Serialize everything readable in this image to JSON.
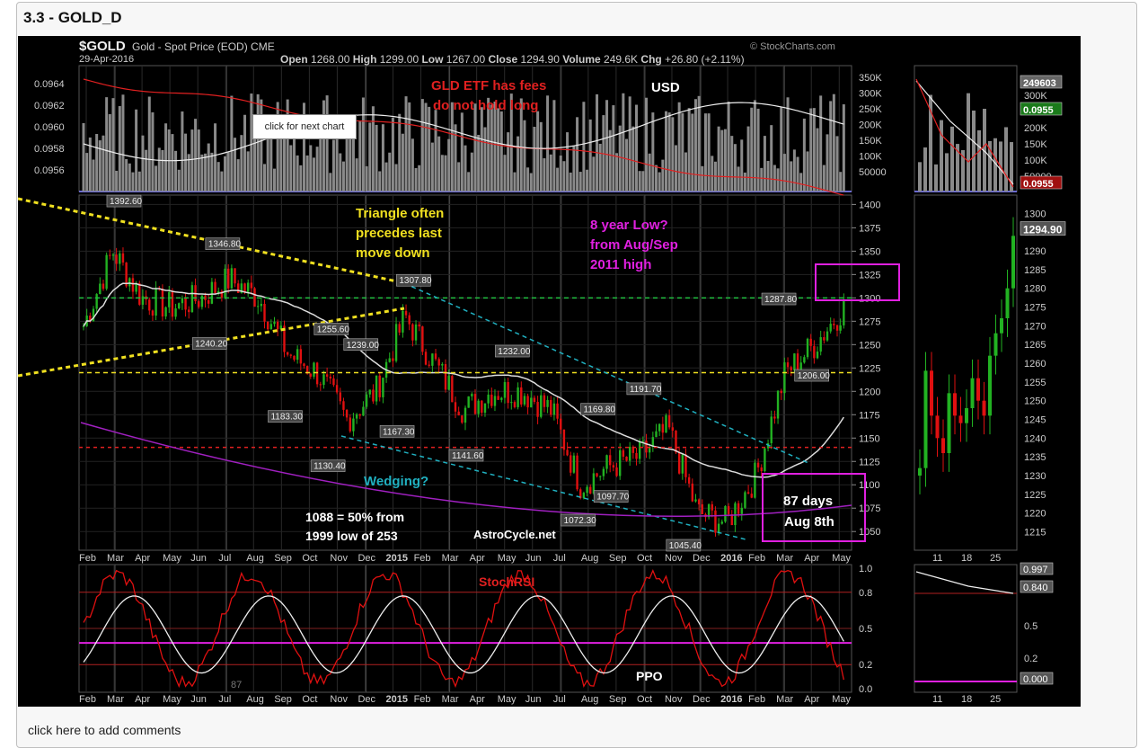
{
  "page": {
    "title": "3.3 - GOLD_D",
    "comments_link": "click here to add comments",
    "next_chart_button": "click for next chart"
  },
  "chart": {
    "symbol": "$GOLD",
    "name": "Gold - Spot Price (EOD)",
    "exchange": "CME",
    "date": "29-Apr-2016",
    "source": "© StockCharts.com",
    "quote": {
      "open": "1268.00",
      "high": "1299.00",
      "low": "1267.00",
      "close": "1294.90",
      "volume": "249.6K",
      "chg": "+26.80 (+2.11%)"
    },
    "quote_labels": {
      "open": "Open",
      "high": "High",
      "low": "Low",
      "close": "Close",
      "volume": "Volume",
      "chg": "Chg"
    },
    "top_axis_left": [
      "0.0964",
      "0.0962",
      "0.0960",
      "0.0958",
      "0.0956"
    ],
    "top_axis_right": [
      "350K",
      "300K",
      "250K",
      "200K",
      "150K",
      "100K",
      "50000"
    ],
    "main_axis_right": [
      "1400",
      "1375",
      "1350",
      "1325",
      "1300",
      "1275",
      "1250",
      "1225",
      "1200",
      "1175",
      "1150",
      "1125",
      "1100",
      "1075",
      "1050"
    ],
    "lower_axis_right": [
      "1.0",
      "0.8",
      "0.5",
      "0.2",
      "0.0"
    ],
    "x_axis_labels": [
      "Feb",
      "Mar",
      "Apr",
      "May",
      "Jun",
      "Jul",
      "Aug",
      "Sep",
      "Oct",
      "Nov",
      "Dec",
      "2015",
      "Feb",
      "Mar",
      "Apr",
      "May",
      "Jun",
      "Jul",
      "Aug",
      "Sep",
      "Oct",
      "Nov",
      "Dec",
      "2016",
      "Feb",
      "Mar",
      "Apr",
      "May"
    ],
    "price_labels": [
      {
        "text": "1392.60",
        "v": 1392.6,
        "i": 12
      },
      {
        "text": "1346.80",
        "v": 1346.8,
        "i": 42
      },
      {
        "text": "1307.80",
        "v": 1307.8,
        "i": 100
      },
      {
        "text": "1255.60",
        "v": 1255.6,
        "i": 75
      },
      {
        "text": "1240.20",
        "v": 1240.2,
        "i": 38
      },
      {
        "text": "1239.00",
        "v": 1239.0,
        "i": 84
      },
      {
        "text": "1183.30",
        "v": 1183.3,
        "i": 61
      },
      {
        "text": "1167.30",
        "v": 1167.3,
        "i": 95
      },
      {
        "text": "1130.40",
        "v": 1130.4,
        "i": 74
      },
      {
        "text": "1232.00",
        "v": 1232.0,
        "i": 130
      },
      {
        "text": "1141.60",
        "v": 1141.6,
        "i": 116
      },
      {
        "text": "1169.80",
        "v": 1169.8,
        "i": 156
      },
      {
        "text": "1191.70",
        "v": 1191.7,
        "i": 170
      },
      {
        "text": "1072.30",
        "v": 1072.3,
        "i": 150
      },
      {
        "text": "1097.70",
        "v": 1097.7,
        "i": 160
      },
      {
        "text": "1045.40",
        "v": 1045.4,
        "i": 182
      },
      {
        "text": "1287.80",
        "v": 1287.8,
        "i": 211
      },
      {
        "text": "1206.00",
        "v": 1206.0,
        "i": 221
      }
    ],
    "annotations": {
      "gld_fees_1": "GLD ETF has fees",
      "gld_fees_2": "do not hold long",
      "usd": "USD",
      "triangle_1": "Triangle often",
      "triangle_2": "precedes last",
      "triangle_3": "move down",
      "low_1": "8 year Low?",
      "low_2": "from Aug/Sep",
      "low_3": "2011 high",
      "wedging": "Wedging?",
      "fifty_1": "1088 = 50% from",
      "fifty_2": "1999  low of 253",
      "astro": "AstroCycle.net",
      "days_1": "87 days",
      "days_2": "Aug 8th",
      "stochrsi": "StochRSI",
      "ppo": "PPO",
      "ppo_value": "87"
    },
    "side_panel": {
      "top_axis": [
        "300K",
        "250K",
        "200K",
        "150K",
        "100K",
        "50000"
      ],
      "top_badges": [
        "249603",
        "0.0955",
        "0.0955"
      ],
      "main_axis": [
        "1300",
        "1295",
        "1290",
        "1285",
        "1280",
        "1275",
        "1270",
        "1265",
        "1260",
        "1255",
        "1250",
        "1245",
        "1240",
        "1235",
        "1230",
        "1225",
        "1220",
        "1215"
      ],
      "close_badge": "1294.90",
      "lower_axis": [
        "0.5",
        "0.2"
      ],
      "lower_badges": [
        "0.997",
        "0.840",
        "0.000"
      ],
      "x_labels": [
        "11",
        "18",
        "25"
      ]
    },
    "colors": {
      "up": "#22b222",
      "down": "#e01010",
      "sma": "#dddddd",
      "stoch": "#e01010",
      "ppo": "#eeeeee",
      "magenta": "#e020e0",
      "yellow": "#f0e020",
      "cyan": "#20b0c0"
    }
  },
  "chart_data": {
    "type": "line",
    "title": "$GOLD Gold - Spot Price (EOD)",
    "xlabel": "",
    "ylabel": "",
    "ylim": [
      1030,
      1410
    ],
    "series": [
      {
        "name": "$GOLD",
        "x": [
          "2014-02",
          "2014-03",
          "2014-04",
          "2014-05",
          "2014-06",
          "2014-07",
          "2014-08",
          "2014-09",
          "2014-10",
          "2014-11",
          "2014-12",
          "2015-01",
          "2015-02",
          "2015-03",
          "2015-04",
          "2015-05",
          "2015-06",
          "2015-07",
          "2015-08",
          "2015-09",
          "2015-10",
          "2015-11",
          "2015-12",
          "2016-01",
          "2016-02",
          "2016-03",
          "2016-04"
        ],
        "values": [
          1270,
          1350,
          1300,
          1290,
          1300,
          1320,
          1300,
          1240,
          1220,
          1170,
          1200,
          1280,
          1230,
          1180,
          1200,
          1200,
          1180,
          1100,
          1120,
          1130,
          1160,
          1070,
          1060,
          1110,
          1220,
          1250,
          1290
        ]
      }
    ]
  }
}
